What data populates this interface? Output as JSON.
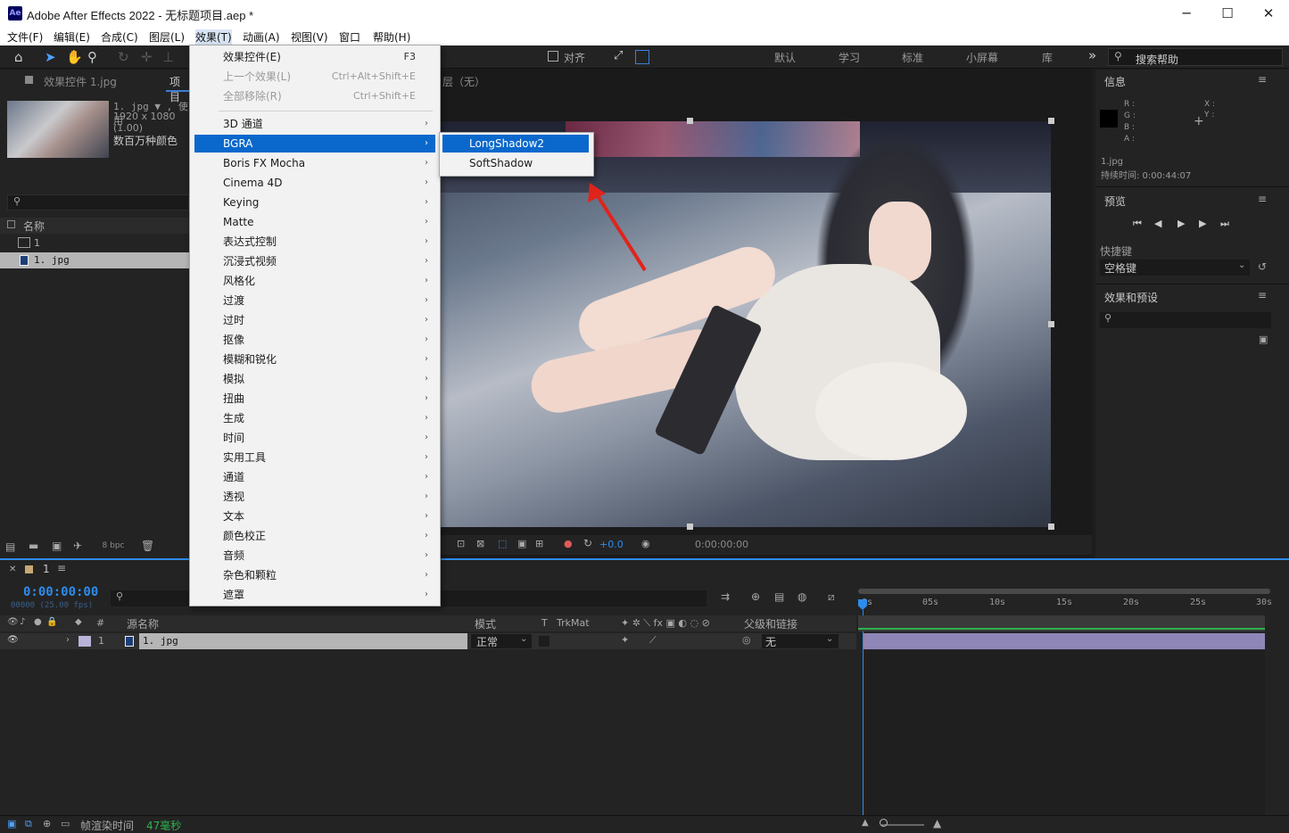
{
  "window": {
    "app_icon": "Ae",
    "title": "Adobe After Effects 2022 - 无标题项目.aep *",
    "minimize": "─",
    "maximize": "☐",
    "close": "✕"
  },
  "menubar": [
    "文件(F)",
    "编辑(E)",
    "合成(C)",
    "图层(L)",
    "效果(T)",
    "动画(A)",
    "视图(V)",
    "窗口",
    "帮助(H)"
  ],
  "toolbar": {
    "align_label": "对齐",
    "workspaces": [
      "默认",
      "学习",
      "标准",
      "小屏幕",
      "库"
    ],
    "more": "»",
    "search_placeholder": "搜索帮助"
  },
  "project_panel": {
    "tab_effect_controls": "效果控件 1.jpg",
    "tab_project": "项目",
    "item_info_name": "1. jpg ▼ , 使用",
    "item_info_dims": "1920 x 1080 (1.00)",
    "item_info_colors": "数百万种颜色",
    "col_name": "名称",
    "rows": [
      "1",
      "1. jpg"
    ],
    "bpc": "8 bpc"
  },
  "composition_header": "层（无）",
  "effects_menu": {
    "items": [
      {
        "label": "效果控件(E)",
        "shortcut": "F3",
        "disabled": false,
        "submenu": false
      },
      {
        "label": "上一个效果(L)",
        "shortcut": "Ctrl+Alt+Shift+E",
        "disabled": true,
        "submenu": false
      },
      {
        "label": "全部移除(R)",
        "shortcut": "Ctrl+Shift+E",
        "disabled": true,
        "submenu": false
      },
      {
        "label": "3D 通道",
        "submenu": true
      },
      {
        "label": "BGRA",
        "submenu": true,
        "highlighted": true
      },
      {
        "label": "Boris FX Mocha",
        "submenu": true
      },
      {
        "label": "Cinema 4D",
        "submenu": true
      },
      {
        "label": "Keying",
        "submenu": true
      },
      {
        "label": "Matte",
        "submenu": true
      },
      {
        "label": "表达式控制",
        "submenu": true
      },
      {
        "label": "沉浸式视频",
        "submenu": true
      },
      {
        "label": "风格化",
        "submenu": true
      },
      {
        "label": "过渡",
        "submenu": true
      },
      {
        "label": "过时",
        "submenu": true
      },
      {
        "label": "抠像",
        "submenu": true
      },
      {
        "label": "模糊和锐化",
        "submenu": true
      },
      {
        "label": "模拟",
        "submenu": true
      },
      {
        "label": "扭曲",
        "submenu": true
      },
      {
        "label": "生成",
        "submenu": true
      },
      {
        "label": "时间",
        "submenu": true
      },
      {
        "label": "实用工具",
        "submenu": true
      },
      {
        "label": "通道",
        "submenu": true
      },
      {
        "label": "透视",
        "submenu": true
      },
      {
        "label": "文本",
        "submenu": true
      },
      {
        "label": "颜色校正",
        "submenu": true
      },
      {
        "label": "音频",
        "submenu": true
      },
      {
        "label": "杂色和颗粒",
        "submenu": true
      },
      {
        "label": "遮罩",
        "submenu": true
      }
    ],
    "arrow_glyph": "›"
  },
  "bgra_submenu": [
    "LongShadow2",
    "SoftShadow"
  ],
  "viewer_controls": {
    "exposure": "+0.0",
    "timecode": "0:00:00:00"
  },
  "info_panel": {
    "title": "信息",
    "r": "R :",
    "g": "G :",
    "b": "B :",
    "a": "A :",
    "x": "X :",
    "y": "Y :",
    "file": "1.jpg",
    "duration": "持续时间: 0:00:44:07"
  },
  "preview_panel": {
    "title": "预览",
    "shortcut_label": "快捷键",
    "shortcut_value": "空格键"
  },
  "effects_presets_panel": {
    "title": "效果和预设"
  },
  "timeline": {
    "comp_tab": "1",
    "timecode": "0:00:00:00",
    "frame_info": "00000 (25.00 fps)",
    "headers": {
      "hash": "#",
      "source_name": "源名称",
      "mode": "模式",
      "t": "T",
      "trkmat": "TrkMat",
      "parent": "父级和链接"
    },
    "layer": {
      "index": "1",
      "name": "1. jpg",
      "mode": "正常",
      "parent": "无"
    },
    "ruler": [
      "0s",
      "05s",
      "10s",
      "15s",
      "20s",
      "25s",
      "30s"
    ],
    "status_render_label": "帧渲染时间",
    "status_render_value": "47毫秒"
  },
  "colors": {
    "accent_blue": "#0a68cc",
    "timecode_blue": "#2d8ceb",
    "layer_bar": "#8f86b8",
    "annotation_arrow": "#e0241c"
  }
}
